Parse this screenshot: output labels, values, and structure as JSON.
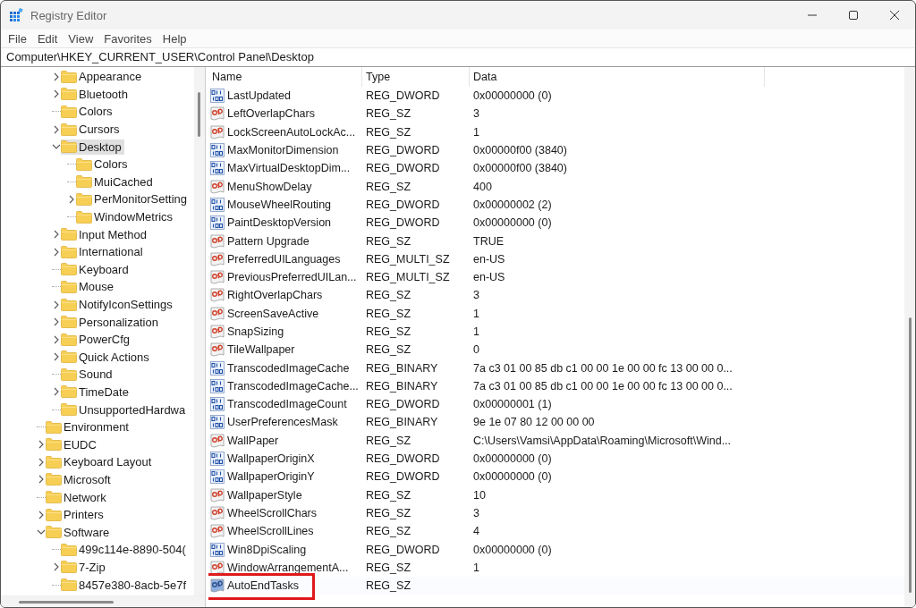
{
  "window": {
    "title": "Registry Editor"
  },
  "menu": [
    "File",
    "Edit",
    "View",
    "Favorites",
    "Help"
  ],
  "address": "Computer\\HKEY_CURRENT_USER\\Control Panel\\Desktop",
  "tree": {
    "items": [
      {
        "children": [
          {
            "label": "Appearance",
            "expanded": false,
            "selected": false
          },
          {
            "label": "Bluetooth",
            "expanded": false,
            "selected": false
          },
          {
            "label": "Colors",
            "selected": false
          },
          {
            "label": "Cursors",
            "expanded": false,
            "selected": false
          },
          {
            "label": "Desktop",
            "expanded": true,
            "selected": true,
            "children": [
              {
                "label": "Colors",
                "selected": false
              },
              {
                "label": "MuiCached",
                "selected": false
              },
              {
                "label": "PerMonitorSetting",
                "expanded": false,
                "selected": false
              },
              {
                "label": "WindowMetrics",
                "selected": false
              }
            ]
          },
          {
            "label": "Input Method",
            "expanded": false,
            "selected": false
          },
          {
            "label": "International",
            "expanded": false,
            "selected": false
          },
          {
            "label": "Keyboard",
            "selected": false
          },
          {
            "label": "Mouse",
            "selected": false
          },
          {
            "label": "NotifyIconSettings",
            "expanded": false,
            "selected": false
          },
          {
            "label": "Personalization",
            "expanded": false,
            "selected": false
          },
          {
            "label": "PowerCfg",
            "expanded": false,
            "selected": false
          },
          {
            "label": "Quick Actions",
            "expanded": false,
            "selected": false
          },
          {
            "label": "Sound",
            "selected": false
          },
          {
            "label": "TimeDate",
            "expanded": false,
            "selected": false
          },
          {
            "label": "UnsupportedHardwa",
            "selected": false
          }
        ]
      },
      {
        "label": "Environment",
        "selected": false
      },
      {
        "label": "EUDC",
        "expanded": false,
        "selected": false
      },
      {
        "label": "Keyboard Layout",
        "expanded": false,
        "selected": false
      },
      {
        "label": "Microsoft",
        "expanded": false,
        "selected": false
      },
      {
        "label": "Network",
        "selected": false
      },
      {
        "label": "Printers",
        "expanded": false,
        "selected": false
      },
      {
        "label": "Software",
        "expanded": true,
        "selected": false,
        "children": [
          {
            "label": "499c114e-8890-504(",
            "selected": false
          },
          {
            "label": "7-Zip",
            "expanded": false,
            "selected": false
          },
          {
            "label": "8457e380-8acb-5e7f",
            "selected": false
          }
        ]
      }
    ]
  },
  "table": {
    "columns": [
      "Name",
      "Type",
      "Data"
    ],
    "rows": [
      {
        "kind": "binary",
        "name": "LastUpdated",
        "type": "REG_DWORD",
        "data": "0x00000000 (0)",
        "selected": false,
        "highlighted": false
      },
      {
        "kind": "string",
        "name": "LeftOverlapChars",
        "type": "REG_SZ",
        "data": "3",
        "selected": false,
        "highlighted": false
      },
      {
        "kind": "string",
        "name": "LockScreenAutoLockAc...",
        "type": "REG_SZ",
        "data": "1",
        "selected": false,
        "highlighted": false
      },
      {
        "kind": "binary",
        "name": "MaxMonitorDimension",
        "type": "REG_DWORD",
        "data": "0x00000f00 (3840)",
        "selected": false,
        "highlighted": false
      },
      {
        "kind": "binary",
        "name": "MaxVirtualDesktopDim...",
        "type": "REG_DWORD",
        "data": "0x00000f00 (3840)",
        "selected": false,
        "highlighted": false
      },
      {
        "kind": "string",
        "name": "MenuShowDelay",
        "type": "REG_SZ",
        "data": "400",
        "selected": false,
        "highlighted": false
      },
      {
        "kind": "binary",
        "name": "MouseWheelRouting",
        "type": "REG_DWORD",
        "data": "0x00000002 (2)",
        "selected": false,
        "highlighted": false
      },
      {
        "kind": "binary",
        "name": "PaintDesktopVersion",
        "type": "REG_DWORD",
        "data": "0x00000000 (0)",
        "selected": false,
        "highlighted": false
      },
      {
        "kind": "string",
        "name": "Pattern Upgrade",
        "type": "REG_SZ",
        "data": "TRUE",
        "selected": false,
        "highlighted": false
      },
      {
        "kind": "string",
        "name": "PreferredUILanguages",
        "type": "REG_MULTI_SZ",
        "data": "en-US",
        "selected": false,
        "highlighted": false
      },
      {
        "kind": "string",
        "name": "PreviousPreferredUILan...",
        "type": "REG_MULTI_SZ",
        "data": "en-US",
        "selected": false,
        "highlighted": false
      },
      {
        "kind": "string",
        "name": "RightOverlapChars",
        "type": "REG_SZ",
        "data": "3",
        "selected": false,
        "highlighted": false
      },
      {
        "kind": "string",
        "name": "ScreenSaveActive",
        "type": "REG_SZ",
        "data": "1",
        "selected": false,
        "highlighted": false
      },
      {
        "kind": "string",
        "name": "SnapSizing",
        "type": "REG_SZ",
        "data": "1",
        "selected": false,
        "highlighted": false
      },
      {
        "kind": "string",
        "name": "TileWallpaper",
        "type": "REG_SZ",
        "data": "0",
        "selected": false,
        "highlighted": false
      },
      {
        "kind": "binary",
        "name": "TranscodedImageCache",
        "type": "REG_BINARY",
        "data": "7a c3 01 00 85 db c1 00 00 1e 00 00 fc 13 00 00 0...",
        "selected": false,
        "highlighted": false
      },
      {
        "kind": "binary",
        "name": "TranscodedImageCache...",
        "type": "REG_BINARY",
        "data": "7a c3 01 00 85 db c1 00 00 1e 00 00 fc 13 00 00 0...",
        "selected": false,
        "highlighted": false
      },
      {
        "kind": "binary",
        "name": "TranscodedImageCount",
        "type": "REG_DWORD",
        "data": "0x00000001 (1)",
        "selected": false,
        "highlighted": false
      },
      {
        "kind": "binary",
        "name": "UserPreferencesMask",
        "type": "REG_BINARY",
        "data": "9e 1e 07 80 12 00 00 00",
        "selected": false,
        "highlighted": false
      },
      {
        "kind": "string",
        "name": "WallPaper",
        "type": "REG_SZ",
        "data": "C:\\Users\\Vamsi\\AppData\\Roaming\\Microsoft\\Wind...",
        "selected": false,
        "highlighted": false
      },
      {
        "kind": "binary",
        "name": "WallpaperOriginX",
        "type": "REG_DWORD",
        "data": "0x00000000 (0)",
        "selected": false,
        "highlighted": false
      },
      {
        "kind": "binary",
        "name": "WallpaperOriginY",
        "type": "REG_DWORD",
        "data": "0x00000000 (0)",
        "selected": false,
        "highlighted": false
      },
      {
        "kind": "string",
        "name": "WallpaperStyle",
        "type": "REG_SZ",
        "data": "10",
        "selected": false,
        "highlighted": false
      },
      {
        "kind": "string",
        "name": "WheelScrollChars",
        "type": "REG_SZ",
        "data": "3",
        "selected": false,
        "highlighted": false
      },
      {
        "kind": "string",
        "name": "WheelScrollLines",
        "type": "REG_SZ",
        "data": "4",
        "selected": false,
        "highlighted": false
      },
      {
        "kind": "binary",
        "name": "Win8DpiScaling",
        "type": "REG_DWORD",
        "data": "0x00000000 (0)",
        "selected": false,
        "highlighted": false
      },
      {
        "kind": "string",
        "name": "WindowArrangementA...",
        "type": "REG_SZ",
        "data": "1",
        "selected": false,
        "highlighted": false
      },
      {
        "kind": "string",
        "name": "AutoEndTasks",
        "type": "REG_SZ",
        "selected": true,
        "highlighted": true
      }
    ]
  }
}
